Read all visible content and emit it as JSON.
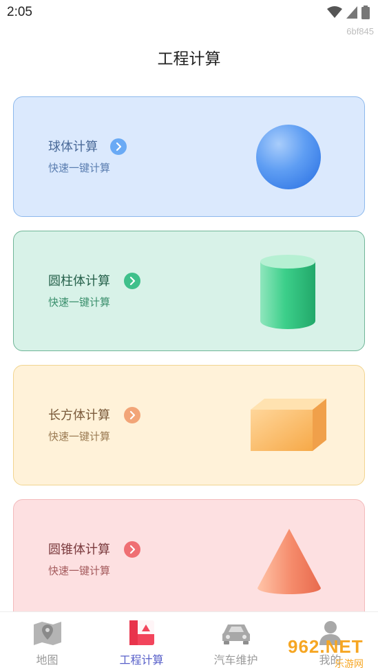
{
  "status_bar": {
    "time": "2:05"
  },
  "watermark_id": "6bf845",
  "page": {
    "title": "工程计算"
  },
  "cards": [
    {
      "title": "球体计算",
      "subtitle": "快速一键计算",
      "shape": "sphere-icon",
      "accent": "#6aaaf5"
    },
    {
      "title": "圆柱体计算",
      "subtitle": "快速一键计算",
      "shape": "cylinder-icon",
      "accent": "#3fc08b"
    },
    {
      "title": "长方体计算",
      "subtitle": "快速一键计算",
      "shape": "cuboid-icon",
      "accent": "#f2a578"
    },
    {
      "title": "圆锥体计算",
      "subtitle": "快速一键计算",
      "shape": "cone-icon",
      "accent": "#ef6f73"
    }
  ],
  "tab_bar": {
    "items": [
      {
        "label": "地图",
        "icon": "map-icon",
        "active": false
      },
      {
        "label": "工程计算",
        "icon": "calculator-icon",
        "active": true
      },
      {
        "label": "汽车维护",
        "icon": "car-icon",
        "active": false
      },
      {
        "label": "我的",
        "icon": "person-icon",
        "active": false
      }
    ],
    "active_color": "#5860c9"
  },
  "site_watermark": {
    "main": "962.NET",
    "sub": "乐游网"
  }
}
